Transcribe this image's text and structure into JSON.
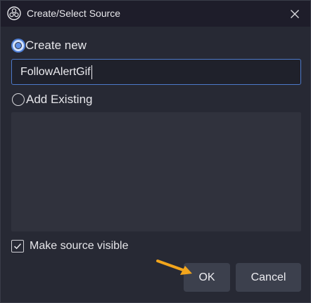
{
  "window": {
    "title": "Create/Select Source",
    "app_icon": "obs-icon",
    "close_icon": "close-icon"
  },
  "create_new": {
    "label": "Create new",
    "selected": true,
    "name_value": "FollowAlertGif"
  },
  "add_existing": {
    "label": "Add Existing",
    "selected": false,
    "items": []
  },
  "visible_option": {
    "label": "Make source visible",
    "checked": true
  },
  "buttons": {
    "ok_label": "OK",
    "cancel_label": "Cancel"
  },
  "annotation": {
    "arrow_color": "#f2a51c",
    "arrow_icon": "pointer-arrow-icon"
  },
  "colors": {
    "accent": "#4d79c9",
    "background": "#272934",
    "titlebar": "#1e1d2a"
  }
}
